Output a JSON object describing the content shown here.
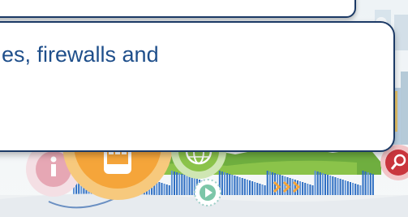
{
  "caption": {
    "text": "es, firewalls and"
  },
  "colors": {
    "border": "#1c3a66",
    "text": "#1f4f8b",
    "orange": "#f5a53a",
    "green": "#8bc34a",
    "red": "#c9353d",
    "pink": "#e6a7b4",
    "blue": "#2e6ec2"
  },
  "icons": [
    "cloud-icon",
    "phone-icon",
    "globe-icon",
    "search-icon",
    "info-icon",
    "play-icon",
    "arrows-icon"
  ]
}
